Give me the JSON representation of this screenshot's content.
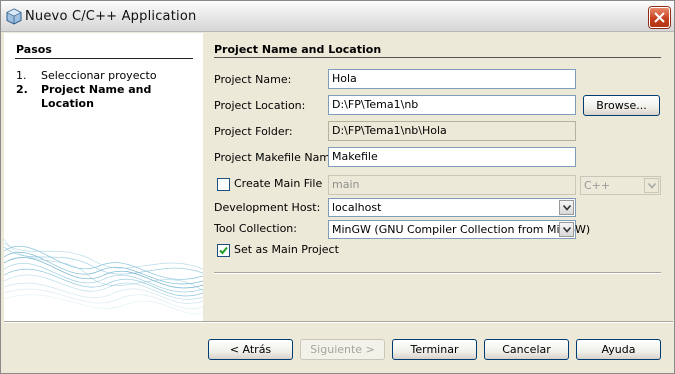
{
  "window": {
    "title": "Nuevo C/C++ Application"
  },
  "steps": {
    "heading": "Pasos",
    "items": [
      {
        "num": "1.",
        "label": "Seleccionar proyecto",
        "current": false
      },
      {
        "num": "2.",
        "label": "Project Name and Location",
        "current": true
      }
    ]
  },
  "panel": {
    "title": "Project Name and Location",
    "project_name": {
      "label": "Project Name:",
      "value": "Hola"
    },
    "project_location": {
      "label": "Project Location:",
      "value": "D:\\FP\\Tema1\\nb",
      "browse": "Browse..."
    },
    "project_folder": {
      "label": "Project Folder:",
      "value": "D:\\FP\\Tema1\\nb\\Hola"
    },
    "makefile_name": {
      "label": "Project Makefile Name:",
      "value": "Makefile"
    },
    "create_main": {
      "label": "Create Main File",
      "checked": false,
      "value": "main",
      "language": "C++"
    },
    "dev_host": {
      "label": "Development Host:",
      "value": "localhost"
    },
    "tool_collection": {
      "label": "Tool Collection:",
      "value": "MinGW (GNU Compiler Collection from MinGW)"
    },
    "main_project": {
      "label": "Set as Main Project",
      "checked": true
    }
  },
  "buttons": {
    "back": "< Atrás",
    "next": "Siguiente >",
    "finish": "Terminar",
    "cancel": "Cancelar",
    "help": "Ayuda"
  },
  "colors": {
    "dialog_bg": "#ece9d8",
    "field_border": "#7f9db9",
    "close_red": "#c7401e",
    "wave_blue": "#5aa7c7"
  }
}
